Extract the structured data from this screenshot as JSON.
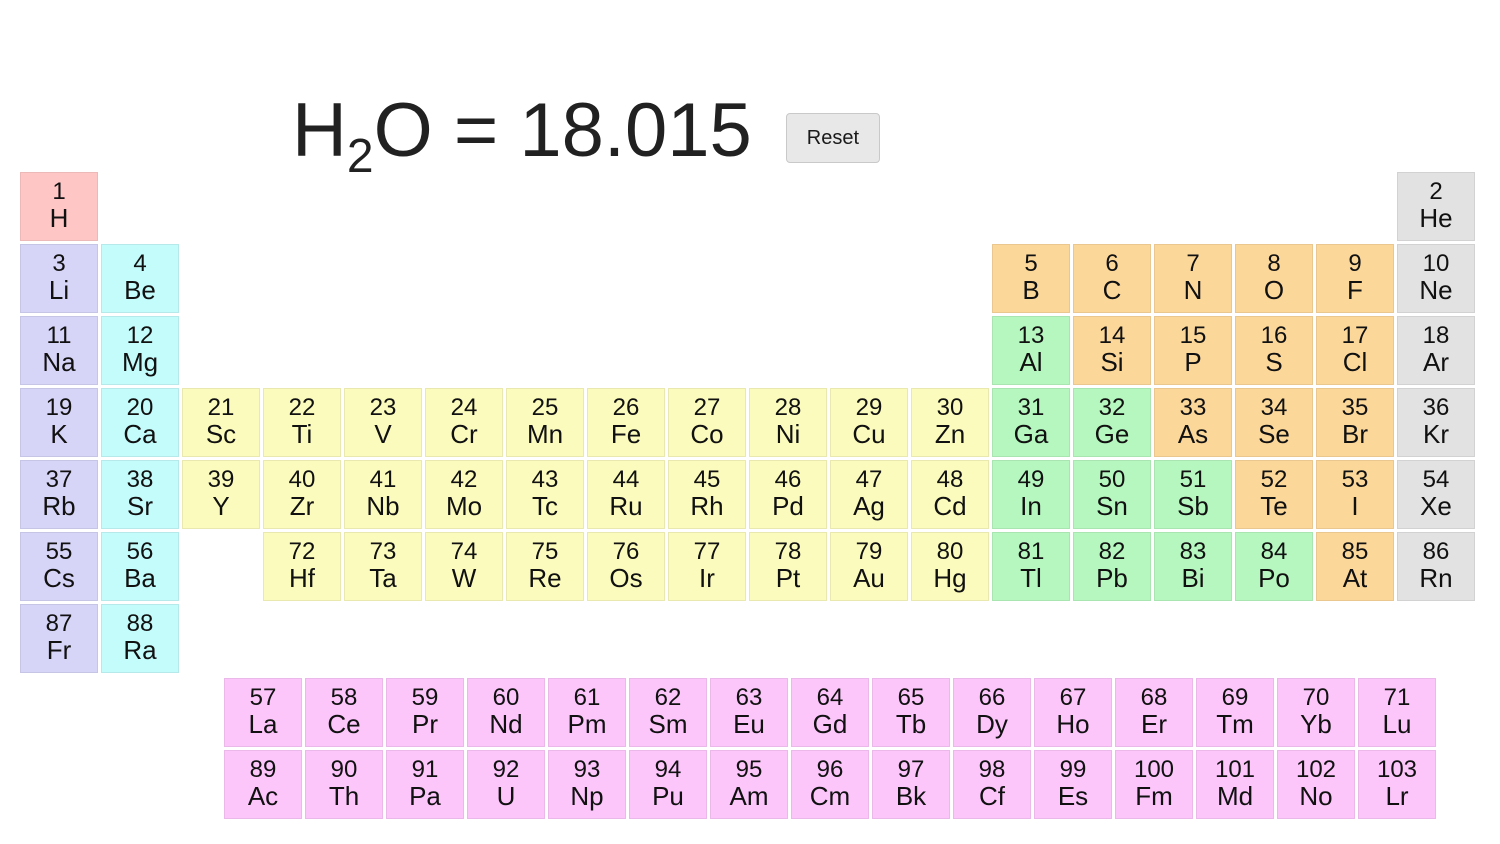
{
  "header": {
    "formula_symbol": "H",
    "formula_subscript": "2",
    "formula_symbol2": "O",
    "formula_equals": " = ",
    "formula_mass": "18.015",
    "formula_full": "H2O = 18.015",
    "reset_label": "Reset"
  },
  "colors": {
    "hydrogen": "#ffc6c6",
    "alkali_metal": "#d6d4f7",
    "alkaline_earth": "#c4fbfb",
    "transition_metal": "#fbfbbd",
    "post_transition": "#b5f7bf",
    "nonmetal": "#fcd79a",
    "noble_gas": "#e2e2e2",
    "lanthanide": "#fcc6fb",
    "actinide": "#fcc6fb",
    "background": "#ffffff",
    "text": "#111111",
    "reset_button_bg": "#e8e8e8"
  },
  "table": {
    "groups": 18,
    "main_periods": 7,
    "fblock_columns": 15,
    "fblock_start_group": 3
  },
  "elements": [
    {
      "number": "1",
      "symbol": "H",
      "group": 1,
      "period": 1,
      "category": "hydrogen"
    },
    {
      "number": "2",
      "symbol": "He",
      "group": 18,
      "period": 1,
      "category": "noble-gas"
    },
    {
      "number": "3",
      "symbol": "Li",
      "group": 1,
      "period": 2,
      "category": "alkali-metal"
    },
    {
      "number": "4",
      "symbol": "Be",
      "group": 2,
      "period": 2,
      "category": "alkaline-earth"
    },
    {
      "number": "5",
      "symbol": "B",
      "group": 13,
      "period": 2,
      "category": "nonmetal"
    },
    {
      "number": "6",
      "symbol": "C",
      "group": 14,
      "period": 2,
      "category": "nonmetal"
    },
    {
      "number": "7",
      "symbol": "N",
      "group": 15,
      "period": 2,
      "category": "nonmetal"
    },
    {
      "number": "8",
      "symbol": "O",
      "group": 16,
      "period": 2,
      "category": "nonmetal"
    },
    {
      "number": "9",
      "symbol": "F",
      "group": 17,
      "period": 2,
      "category": "nonmetal"
    },
    {
      "number": "10",
      "symbol": "Ne",
      "group": 18,
      "period": 2,
      "category": "noble-gas"
    },
    {
      "number": "11",
      "symbol": "Na",
      "group": 1,
      "period": 3,
      "category": "alkali-metal"
    },
    {
      "number": "12",
      "symbol": "Mg",
      "group": 2,
      "period": 3,
      "category": "alkaline-earth"
    },
    {
      "number": "13",
      "symbol": "Al",
      "group": 13,
      "period": 3,
      "category": "post-transition"
    },
    {
      "number": "14",
      "symbol": "Si",
      "group": 14,
      "period": 3,
      "category": "nonmetal"
    },
    {
      "number": "15",
      "symbol": "P",
      "group": 15,
      "period": 3,
      "category": "nonmetal"
    },
    {
      "number": "16",
      "symbol": "S",
      "group": 16,
      "period": 3,
      "category": "nonmetal"
    },
    {
      "number": "17",
      "symbol": "Cl",
      "group": 17,
      "period": 3,
      "category": "nonmetal"
    },
    {
      "number": "18",
      "symbol": "Ar",
      "group": 18,
      "period": 3,
      "category": "noble-gas"
    },
    {
      "number": "19",
      "symbol": "K",
      "group": 1,
      "period": 4,
      "category": "alkali-metal"
    },
    {
      "number": "20",
      "symbol": "Ca",
      "group": 2,
      "period": 4,
      "category": "alkaline-earth"
    },
    {
      "number": "21",
      "symbol": "Sc",
      "group": 3,
      "period": 4,
      "category": "transition-metal"
    },
    {
      "number": "22",
      "symbol": "Ti",
      "group": 4,
      "period": 4,
      "category": "transition-metal"
    },
    {
      "number": "23",
      "symbol": "V",
      "group": 5,
      "period": 4,
      "category": "transition-metal"
    },
    {
      "number": "24",
      "symbol": "Cr",
      "group": 6,
      "period": 4,
      "category": "transition-metal"
    },
    {
      "number": "25",
      "symbol": "Mn",
      "group": 7,
      "period": 4,
      "category": "transition-metal"
    },
    {
      "number": "26",
      "symbol": "Fe",
      "group": 8,
      "period": 4,
      "category": "transition-metal"
    },
    {
      "number": "27",
      "symbol": "Co",
      "group": 9,
      "period": 4,
      "category": "transition-metal"
    },
    {
      "number": "28",
      "symbol": "Ni",
      "group": 10,
      "period": 4,
      "category": "transition-metal"
    },
    {
      "number": "29",
      "symbol": "Cu",
      "group": 11,
      "period": 4,
      "category": "transition-metal"
    },
    {
      "number": "30",
      "symbol": "Zn",
      "group": 12,
      "period": 4,
      "category": "transition-metal"
    },
    {
      "number": "31",
      "symbol": "Ga",
      "group": 13,
      "period": 4,
      "category": "post-transition"
    },
    {
      "number": "32",
      "symbol": "Ge",
      "group": 14,
      "period": 4,
      "category": "post-transition"
    },
    {
      "number": "33",
      "symbol": "As",
      "group": 15,
      "period": 4,
      "category": "nonmetal"
    },
    {
      "number": "34",
      "symbol": "Se",
      "group": 16,
      "period": 4,
      "category": "nonmetal"
    },
    {
      "number": "35",
      "symbol": "Br",
      "group": 17,
      "period": 4,
      "category": "nonmetal"
    },
    {
      "number": "36",
      "symbol": "Kr",
      "group": 18,
      "period": 4,
      "category": "noble-gas"
    },
    {
      "number": "37",
      "symbol": "Rb",
      "group": 1,
      "period": 5,
      "category": "alkali-metal"
    },
    {
      "number": "38",
      "symbol": "Sr",
      "group": 2,
      "period": 5,
      "category": "alkaline-earth"
    },
    {
      "number": "39",
      "symbol": "Y",
      "group": 3,
      "period": 5,
      "category": "transition-metal"
    },
    {
      "number": "40",
      "symbol": "Zr",
      "group": 4,
      "period": 5,
      "category": "transition-metal"
    },
    {
      "number": "41",
      "symbol": "Nb",
      "group": 5,
      "period": 5,
      "category": "transition-metal"
    },
    {
      "number": "42",
      "symbol": "Mo",
      "group": 6,
      "period": 5,
      "category": "transition-metal"
    },
    {
      "number": "43",
      "symbol": "Tc",
      "group": 7,
      "period": 5,
      "category": "transition-metal"
    },
    {
      "number": "44",
      "symbol": "Ru",
      "group": 8,
      "period": 5,
      "category": "transition-metal"
    },
    {
      "number": "45",
      "symbol": "Rh",
      "group": 9,
      "period": 5,
      "category": "transition-metal"
    },
    {
      "number": "46",
      "symbol": "Pd",
      "group": 10,
      "period": 5,
      "category": "transition-metal"
    },
    {
      "number": "47",
      "symbol": "Ag",
      "group": 11,
      "period": 5,
      "category": "transition-metal"
    },
    {
      "number": "48",
      "symbol": "Cd",
      "group": 12,
      "period": 5,
      "category": "transition-metal"
    },
    {
      "number": "49",
      "symbol": "In",
      "group": 13,
      "period": 5,
      "category": "post-transition"
    },
    {
      "number": "50",
      "symbol": "Sn",
      "group": 14,
      "period": 5,
      "category": "post-transition"
    },
    {
      "number": "51",
      "symbol": "Sb",
      "group": 15,
      "period": 5,
      "category": "post-transition"
    },
    {
      "number": "52",
      "symbol": "Te",
      "group": 16,
      "period": 5,
      "category": "nonmetal"
    },
    {
      "number": "53",
      "symbol": "I",
      "group": 17,
      "period": 5,
      "category": "nonmetal"
    },
    {
      "number": "54",
      "symbol": "Xe",
      "group": 18,
      "period": 5,
      "category": "noble-gas"
    },
    {
      "number": "55",
      "symbol": "Cs",
      "group": 1,
      "period": 6,
      "category": "alkali-metal"
    },
    {
      "number": "56",
      "symbol": "Ba",
      "group": 2,
      "period": 6,
      "category": "alkaline-earth"
    },
    {
      "number": "72",
      "symbol": "Hf",
      "group": 4,
      "period": 6,
      "category": "transition-metal"
    },
    {
      "number": "73",
      "symbol": "Ta",
      "group": 5,
      "period": 6,
      "category": "transition-metal"
    },
    {
      "number": "74",
      "symbol": "W",
      "group": 6,
      "period": 6,
      "category": "transition-metal"
    },
    {
      "number": "75",
      "symbol": "Re",
      "group": 7,
      "period": 6,
      "category": "transition-metal"
    },
    {
      "number": "76",
      "symbol": "Os",
      "group": 8,
      "period": 6,
      "category": "transition-metal"
    },
    {
      "number": "77",
      "symbol": "Ir",
      "group": 9,
      "period": 6,
      "category": "transition-metal"
    },
    {
      "number": "78",
      "symbol": "Pt",
      "group": 10,
      "period": 6,
      "category": "transition-metal"
    },
    {
      "number": "79",
      "symbol": "Au",
      "group": 11,
      "period": 6,
      "category": "transition-metal"
    },
    {
      "number": "80",
      "symbol": "Hg",
      "group": 12,
      "period": 6,
      "category": "transition-metal"
    },
    {
      "number": "81",
      "symbol": "Tl",
      "group": 13,
      "period": 6,
      "category": "post-transition"
    },
    {
      "number": "82",
      "symbol": "Pb",
      "group": 14,
      "period": 6,
      "category": "post-transition"
    },
    {
      "number": "83",
      "symbol": "Bi",
      "group": 15,
      "period": 6,
      "category": "post-transition"
    },
    {
      "number": "84",
      "symbol": "Po",
      "group": 16,
      "period": 6,
      "category": "post-transition"
    },
    {
      "number": "85",
      "symbol": "At",
      "group": 17,
      "period": 6,
      "category": "nonmetal"
    },
    {
      "number": "86",
      "symbol": "Rn",
      "group": 18,
      "period": 6,
      "category": "noble-gas"
    },
    {
      "number": "87",
      "symbol": "Fr",
      "group": 1,
      "period": 7,
      "category": "alkali-metal"
    },
    {
      "number": "88",
      "symbol": "Ra",
      "group": 2,
      "period": 7,
      "category": "alkaline-earth"
    }
  ],
  "lanthanides": [
    {
      "number": "57",
      "symbol": "La",
      "category": "lanthanide"
    },
    {
      "number": "58",
      "symbol": "Ce",
      "category": "lanthanide"
    },
    {
      "number": "59",
      "symbol": "Pr",
      "category": "lanthanide"
    },
    {
      "number": "60",
      "symbol": "Nd",
      "category": "lanthanide"
    },
    {
      "number": "61",
      "symbol": "Pm",
      "category": "lanthanide"
    },
    {
      "number": "62",
      "symbol": "Sm",
      "category": "lanthanide"
    },
    {
      "number": "63",
      "symbol": "Eu",
      "category": "lanthanide"
    },
    {
      "number": "64",
      "symbol": "Gd",
      "category": "lanthanide"
    },
    {
      "number": "65",
      "symbol": "Tb",
      "category": "lanthanide"
    },
    {
      "number": "66",
      "symbol": "Dy",
      "category": "lanthanide"
    },
    {
      "number": "67",
      "symbol": "Ho",
      "category": "lanthanide"
    },
    {
      "number": "68",
      "symbol": "Er",
      "category": "lanthanide"
    },
    {
      "number": "69",
      "symbol": "Tm",
      "category": "lanthanide"
    },
    {
      "number": "70",
      "symbol": "Yb",
      "category": "lanthanide"
    },
    {
      "number": "71",
      "symbol": "Lu",
      "category": "lanthanide"
    }
  ],
  "actinides": [
    {
      "number": "89",
      "symbol": "Ac",
      "category": "actinide"
    },
    {
      "number": "90",
      "symbol": "Th",
      "category": "actinide"
    },
    {
      "number": "91",
      "symbol": "Pa",
      "category": "actinide"
    },
    {
      "number": "92",
      "symbol": "U",
      "category": "actinide"
    },
    {
      "number": "93",
      "symbol": "Np",
      "category": "actinide"
    },
    {
      "number": "94",
      "symbol": "Pu",
      "category": "actinide"
    },
    {
      "number": "95",
      "symbol": "Am",
      "category": "actinide"
    },
    {
      "number": "96",
      "symbol": "Cm",
      "category": "actinide"
    },
    {
      "number": "97",
      "symbol": "Bk",
      "category": "actinide"
    },
    {
      "number": "98",
      "symbol": "Cf",
      "category": "actinide"
    },
    {
      "number": "99",
      "symbol": "Es",
      "category": "actinide"
    },
    {
      "number": "100",
      "symbol": "Fm",
      "category": "actinide"
    },
    {
      "number": "101",
      "symbol": "Md",
      "category": "actinide"
    },
    {
      "number": "102",
      "symbol": "No",
      "category": "actinide"
    },
    {
      "number": "103",
      "symbol": "Lr",
      "category": "actinide"
    }
  ]
}
